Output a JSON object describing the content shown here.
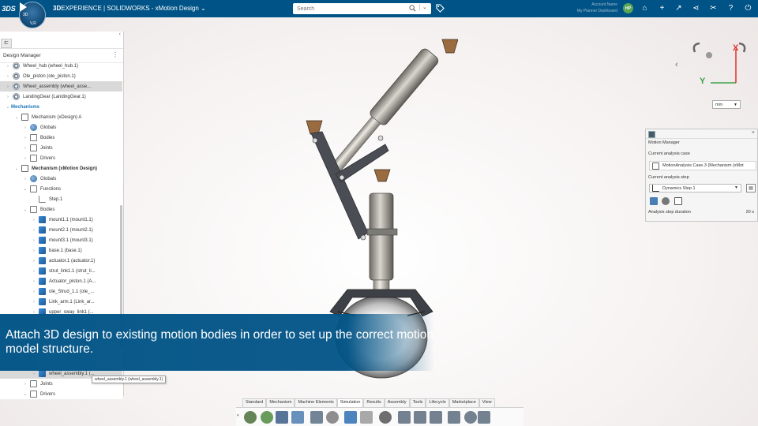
{
  "topbar": {
    "brand": "3DS",
    "compass_labels": [
      "3D",
      "V,R"
    ],
    "app_prefix": "3D",
    "app_brand": "EXPERIENCE",
    "app_suffix": " | SOLIDWORKS - xMotion Design",
    "app_dropdown": "⌄",
    "search_placeholder": "Search",
    "user_line1": "Account Name",
    "user_line2": "My Planner Dashboard",
    "avatar_initials": "HP",
    "icons": [
      "share-icon",
      "plus-icon",
      "share-send-icon",
      "network-icon",
      "tools-icon",
      "help-icon",
      "power-icon"
    ]
  },
  "design_manager": {
    "title": "Design Manager",
    "menu": "⋮",
    "collapse": "‹",
    "tree_tab": "⊏",
    "rows": [
      {
        "label": "Wheel_hub (wheel_hub.1)",
        "kind": "asm",
        "indent": 1,
        "twisty": "›"
      },
      {
        "label": "Ole_piston (ole_piston.1)",
        "kind": "asm",
        "indent": 1,
        "twisty": "›"
      },
      {
        "label": "Wheel_assembly (wheel_asse...",
        "kind": "asm",
        "indent": 1,
        "twisty": "›",
        "selected": true
      },
      {
        "label": "LandingGear (LandingGear.1)",
        "kind": "asm",
        "indent": 1,
        "twisty": "›"
      },
      {
        "label": "Mechanisms",
        "kind": "none",
        "indent": 1,
        "twisty": "⌄",
        "mech": true
      },
      {
        "label": "Mechanism (xDesign) A",
        "kind": "mech",
        "indent": 2,
        "twisty": "⌄"
      },
      {
        "label": "Globals",
        "kind": "globe",
        "indent": 3,
        "twisty": "›"
      },
      {
        "label": "Bodies",
        "kind": "folder",
        "indent": 3,
        "twisty": "›"
      },
      {
        "label": "Joints",
        "kind": "folder",
        "indent": 3,
        "twisty": "›"
      },
      {
        "label": "Drivers",
        "kind": "folder",
        "indent": 3,
        "twisty": "›"
      },
      {
        "label": "Mechanism (xMotion Design)",
        "kind": "mech",
        "indent": 2,
        "twisty": "⌄",
        "bold": true
      },
      {
        "label": "Globals",
        "kind": "globe",
        "indent": 3,
        "twisty": "›"
      },
      {
        "label": "Functions",
        "kind": "folder",
        "indent": 3,
        "twisty": "⌄"
      },
      {
        "label": "Step.1",
        "kind": "step",
        "indent": 4,
        "twisty": ""
      },
      {
        "label": "Bodies",
        "kind": "folder",
        "indent": 3,
        "twisty": "⌄"
      },
      {
        "label": "mount1.1 (mount1.1)",
        "kind": "body",
        "indent": 4,
        "twisty": "›"
      },
      {
        "label": "mount2.1 (mount2.1)",
        "kind": "body",
        "indent": 4,
        "twisty": "›"
      },
      {
        "label": "mount3.1 (mount3.1)",
        "kind": "body",
        "indent": 4,
        "twisty": "›"
      },
      {
        "label": "base.1 (base.1)",
        "kind": "body",
        "indent": 4,
        "twisty": "›"
      },
      {
        "label": "actuator.1 (actuator.1)",
        "kind": "body",
        "indent": 4,
        "twisty": "›"
      },
      {
        "label": "strut_link1.1 (strut_li...",
        "kind": "body",
        "indent": 4,
        "twisty": "›"
      },
      {
        "label": "Actuator_piston.1 (A...",
        "kind": "body",
        "indent": 4,
        "twisty": "›"
      },
      {
        "label": "ole_Strud_1.1 (ole_...",
        "kind": "body",
        "indent": 4,
        "twisty": "›"
      },
      {
        "label": "Link_arm.1 (Link_ar...",
        "kind": "body",
        "indent": 4,
        "twisty": "›"
      },
      {
        "label": "upper_sway_link1 (...",
        "kind": "body",
        "indent": 4,
        "twisty": "›"
      }
    ],
    "bottom_rows": [
      {
        "label": "wheel_assembly.1 (...",
        "kind": "body",
        "indent": 4,
        "twisty": "›",
        "selected": true
      },
      {
        "label": "Joints",
        "kind": "folder",
        "indent": 3,
        "twisty": "›"
      },
      {
        "label": "Drivers",
        "kind": "folder",
        "indent": 3,
        "twisty": "⌄"
      }
    ],
    "hover_tooltip": "wheel_assembly.1 (wheel_assembly.1)"
  },
  "banner": {
    "text": "Attach 3D design to existing motion bodies in order to set up the correct motion model structure."
  },
  "motion_manager": {
    "title": "Motion Manager",
    "close": "×",
    "case_label": "Current analysis case",
    "case_value": "MotionAnalysis Case.3 (Mechanism (xMot",
    "step_label": "Current analysis step",
    "step_value": "Dynamics Step.1",
    "step_arrow": "▼",
    "duration_label": "Analysis step duration",
    "duration_value": "20 s"
  },
  "triad": {
    "x_label": "X",
    "y_label": "Y",
    "nav_left": "‹",
    "units": "mm",
    "units_arrow": "▼"
  },
  "action_bar": {
    "tabs": [
      "Standard",
      "Mechanism",
      "Machine Elements",
      "Simulation",
      "Results",
      "Assembly",
      "Tools",
      "Lifecycle",
      "Marketplace",
      "View"
    ],
    "active_tab": "Simulation",
    "tools": [
      "settings-gear-icon",
      "gear-play-icon",
      "save-icon",
      "refresh-icon",
      "copy-icon",
      "cog-icon",
      "undo-icon",
      "redo-icon",
      "help-icon",
      "doc-flag-icon",
      "doc-edit-icon",
      "doc-chart-icon",
      "doc-link-icon",
      "doc-gear-icon",
      "doc-list-icon"
    ]
  },
  "colors": {
    "topbar": "#005386",
    "accent_x": "#e0302a",
    "accent_y": "#3aa04a",
    "mech_label": "#1a79b8",
    "selection": "#d9d9d9"
  }
}
